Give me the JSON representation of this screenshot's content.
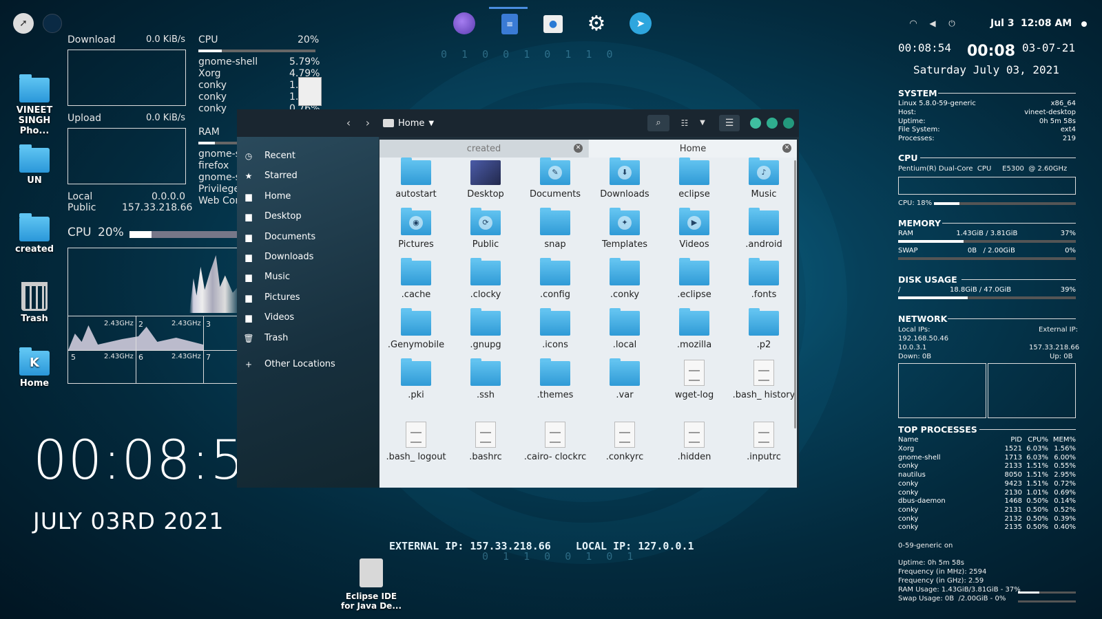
{
  "topbar": {
    "date": "Jul 3",
    "time": "12:08 AM"
  },
  "desktop_icons": [
    {
      "label": "VINEET SINGH Pho..."
    },
    {
      "label": "UN"
    },
    {
      "label": "created"
    },
    {
      "label": "Trash"
    },
    {
      "label": "Home"
    }
  ],
  "bottom_launcher": {
    "label": "Eclipse IDE for Java De..."
  },
  "big_clock": {
    "time": "00:08:5",
    "date": "JULY 03RD 2021"
  },
  "ip_banner": {
    "text": "EXTERNAL IP: 157.33.218.66    LOCAL IP: 127.0.0.1"
  },
  "conky_left": {
    "download_label": "Download",
    "download_value": "0.0 KiB/s",
    "upload_label": "Upload",
    "upload_value": "0.0 KiB/s",
    "local_label": "Local",
    "local_value": "0.0.0.0",
    "public_label": "Public",
    "public_value": "157.33.218.66",
    "cpu_label": "CPU",
    "cpu_value": "20%",
    "cpu_fraction": 0.2,
    "cpu_big_label": "CPU",
    "cpu_big_value": "20%",
    "procs": [
      {
        "name": "gnome-shell",
        "value": "5.79%"
      },
      {
        "name": "Xorg",
        "value": "4.79%"
      },
      {
        "name": "conky",
        "value": "1.2"
      },
      {
        "name": "conky",
        "value": "1.2"
      },
      {
        "name": "conky",
        "value": "0.76%"
      }
    ],
    "ram_label": "RAM",
    "ram_procs": [
      "gnome-sc",
      "firefox",
      "gnome-sh",
      "Privilege",
      "Web Cont"
    ],
    "cores": [
      {
        "n": "",
        "f": "2.43GHz"
      },
      {
        "n": "2",
        "f": "2.43GHz"
      },
      {
        "n": "3",
        "f": ""
      },
      {
        "n": "5",
        "f": "2.43GHz"
      },
      {
        "n": "6",
        "f": "2.43GHz"
      },
      {
        "n": "7",
        "f": ""
      }
    ]
  },
  "file_manager": {
    "location": "Home",
    "sidebar": [
      "Recent",
      "Starred",
      "Home",
      "Desktop",
      "Documents",
      "Downloads",
      "Music",
      "Pictures",
      "Videos",
      "Trash",
      "Other Locations"
    ],
    "tabs": [
      {
        "label": "created"
      },
      {
        "label": "Home"
      }
    ],
    "files": [
      {
        "name": "autostart",
        "t": "fold"
      },
      {
        "name": "Desktop",
        "t": "kde"
      },
      {
        "name": "Documents",
        "t": "fold",
        "e": "✎"
      },
      {
        "name": "Downloads",
        "t": "fold",
        "e": "⬇"
      },
      {
        "name": "eclipse",
        "t": "fold"
      },
      {
        "name": "Music",
        "t": "fold",
        "e": "♪"
      },
      {
        "name": "Pictures",
        "t": "fold",
        "e": "◉"
      },
      {
        "name": "Public",
        "t": "fold",
        "e": "⟳"
      },
      {
        "name": "snap",
        "t": "fold"
      },
      {
        "name": "Templates",
        "t": "fold",
        "e": "✦"
      },
      {
        "name": "Videos",
        "t": "fold",
        "e": "▶"
      },
      {
        "name": ".android",
        "t": "fold"
      },
      {
        "name": ".cache",
        "t": "fold"
      },
      {
        "name": ".clocky",
        "t": "fold"
      },
      {
        "name": ".config",
        "t": "fold"
      },
      {
        "name": ".conky",
        "t": "fold"
      },
      {
        "name": ".eclipse",
        "t": "fold"
      },
      {
        "name": ".fonts",
        "t": "fold"
      },
      {
        "name": ".Genymobile",
        "t": "fold"
      },
      {
        "name": ".gnupg",
        "t": "fold"
      },
      {
        "name": ".icons",
        "t": "fold"
      },
      {
        "name": ".local",
        "t": "fold"
      },
      {
        "name": ".mozilla",
        "t": "fold"
      },
      {
        "name": ".p2",
        "t": "fold"
      },
      {
        "name": ".pki",
        "t": "fold"
      },
      {
        "name": ".ssh",
        "t": "fold"
      },
      {
        "name": ".themes",
        "t": "fold"
      },
      {
        "name": ".var",
        "t": "fold"
      },
      {
        "name": "wget-log",
        "t": "doc"
      },
      {
        "name": ".bash_ history",
        "t": "doc"
      },
      {
        "name": ".bash_ logout",
        "t": "doc"
      },
      {
        "name": ".bashrc",
        "t": "doc"
      },
      {
        "name": ".cairo- clockrc",
        "t": "doc"
      },
      {
        "name": ".conkyrc",
        "t": "doc"
      },
      {
        "name": ".hidden",
        "t": "doc"
      },
      {
        "name": ".inputrc",
        "t": "doc"
      }
    ]
  },
  "conky_right": {
    "time_small": "00:08:54",
    "time_big": "00:08",
    "date_short": "03-07-21",
    "date_long": "Saturday July 03, 2021",
    "system_title": "SYSTEM",
    "system": [
      {
        "k": "Linux 5.8.0-59-generic",
        "v": "x86_64"
      },
      {
        "k": "Host:",
        "v": "vineet-desktop"
      },
      {
        "k": "Uptime:",
        "v": "0h 5m 58s"
      },
      {
        "k": "File System:",
        "v": "ext4"
      },
      {
        "k": "Processes:",
        "v": "219"
      }
    ],
    "cpu_title": "CPU",
    "cpu_model": "Pentium(R) Dual-Core  CPU     E5300  @ 2.60GHz",
    "cpu_usage": "CPU: 18%",
    "cpu_fraction": 0.18,
    "memory_title": "MEMORY",
    "ram": {
      "label": "RAM",
      "value": "1.43GiB / 3.81GiB",
      "pct": "37%",
      "fraction": 0.37
    },
    "swap": {
      "label": "SWAP",
      "value": "0B   / 2.00GiB",
      "pct": "0%",
      "fraction": 0.0
    },
    "disk_title": "DISK USAGE",
    "disk": {
      "label": "/",
      "value": "18.8GiB / 47.0GiB",
      "pct": "39%",
      "fraction": 0.39
    },
    "network_title": "NETWORK",
    "local_ips_label": "Local IPs:",
    "external_ip_label": "External IP:",
    "local_ip1": "192.168.50.46",
    "local_ip2": "10.0.3.1",
    "external_ip": "157.33.218.66",
    "down": "Down: 0B",
    "up": "Up: 0B",
    "top_title": "TOP PROCESSES",
    "top_header": {
      "name": "Name",
      "pid": "PID",
      "cpu": "CPU%",
      "mem": "MEM%"
    },
    "top": [
      {
        "name": "Xorg",
        "pid": "1521",
        "cpu": "6.03%",
        "mem": "1.56%"
      },
      {
        "name": "gnome-shell",
        "pid": "1713",
        "cpu": "6.03%",
        "mem": "6.00%"
      },
      {
        "name": "conky",
        "pid": "2133",
        "cpu": "1.51%",
        "mem": "0.55%"
      },
      {
        "name": "nautilus",
        "pid": "8050",
        "cpu": "1.51%",
        "mem": "2.95%"
      },
      {
        "name": "conky",
        "pid": "9423",
        "cpu": "1.51%",
        "mem": "0.72%"
      },
      {
        "name": "conky",
        "pid": "2130",
        "cpu": "1.01%",
        "mem": "0.69%"
      },
      {
        "name": "dbus-daemon",
        "pid": "1468",
        "cpu": "0.50%",
        "mem": "0.14%"
      },
      {
        "name": "conky",
        "pid": "2131",
        "cpu": "0.50%",
        "mem": "0.52%"
      },
      {
        "name": "conky",
        "pid": "2132",
        "cpu": "0.50%",
        "mem": "0.39%"
      },
      {
        "name": "conky",
        "pid": "2135",
        "cpu": "0.50%",
        "mem": "0.40%"
      }
    ],
    "footer": [
      "0-59-generic on",
      "Uptime: 0h 5m 58s",
      "Frequency (in MHz): 2594",
      "Frequency (in GHz): 2.59",
      "RAM Usage: 1.43GiB/3.81GiB - 37%",
      "Swap Usage: 0B  /2.00GiB - 0%"
    ]
  }
}
